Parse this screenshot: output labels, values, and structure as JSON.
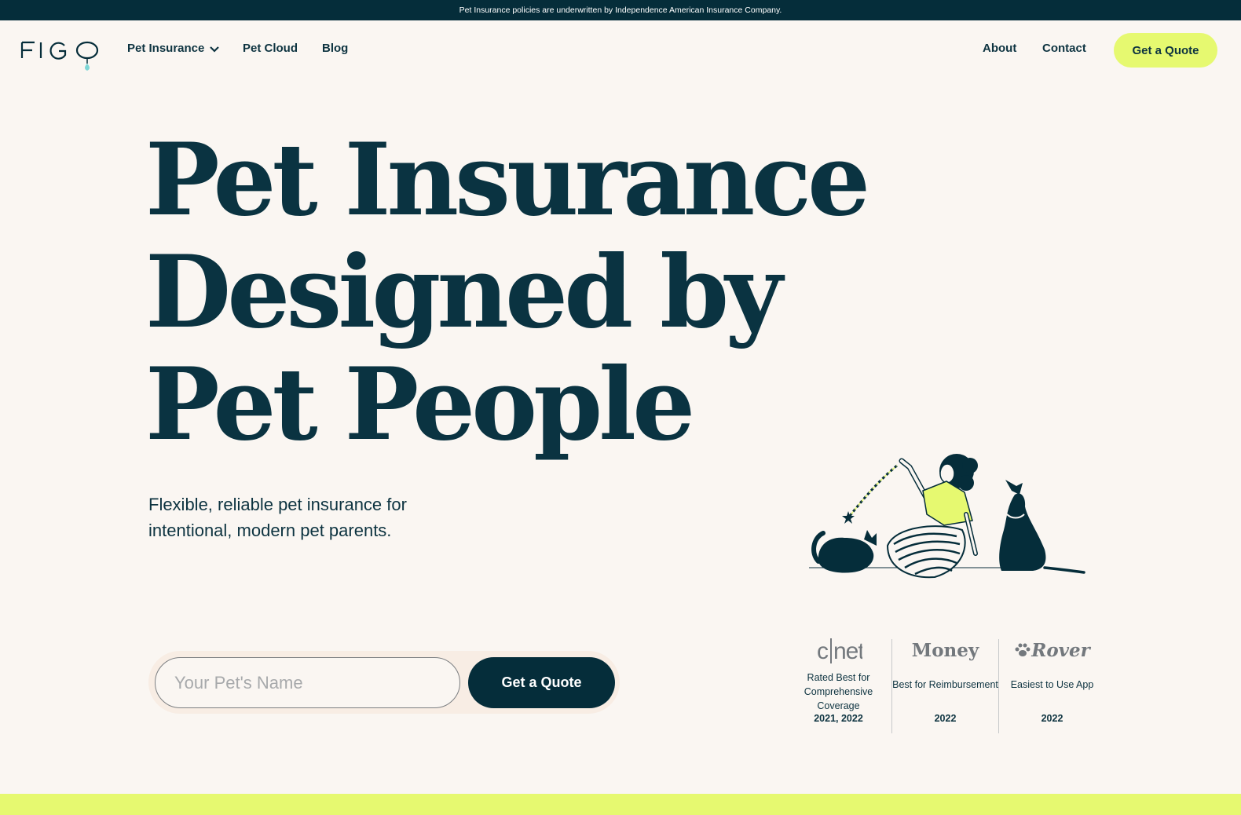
{
  "topbar": {
    "text": "Pet Insurance policies are underwritten by Independence American Insurance Company."
  },
  "logo": {
    "text": "FIGO"
  },
  "nav": {
    "left": [
      {
        "label": "Pet Insurance",
        "icon": "chevron-down-icon"
      },
      {
        "label": "Pet Cloud"
      },
      {
        "label": "Blog"
      }
    ],
    "right": [
      {
        "label": "About"
      },
      {
        "label": "Contact"
      }
    ],
    "cta": "Get a Quote"
  },
  "hero": {
    "title_lines": [
      "Pet Insurance",
      "Designed by",
      "Pet People"
    ],
    "subtitle": "Flexible, reliable pet insurance for intentional, modern pet parents."
  },
  "form": {
    "placeholder": "Your Pet's Name",
    "value": "",
    "button": "Get a Quote"
  },
  "awards": [
    {
      "brand": "c|net",
      "desc": "Rated Best for Comprehensive Coverage",
      "year": "2021, 2022"
    },
    {
      "brand": "Money",
      "desc": "Best for Reimbursement",
      "year": "2022"
    },
    {
      "brand": "Rover",
      "desc": "Easiest to Use App",
      "year": "2022"
    }
  ],
  "colors": {
    "navy": "#052d3a",
    "accent": "#e6f970",
    "background": "#faf6f2",
    "text": "#0d3340"
  }
}
